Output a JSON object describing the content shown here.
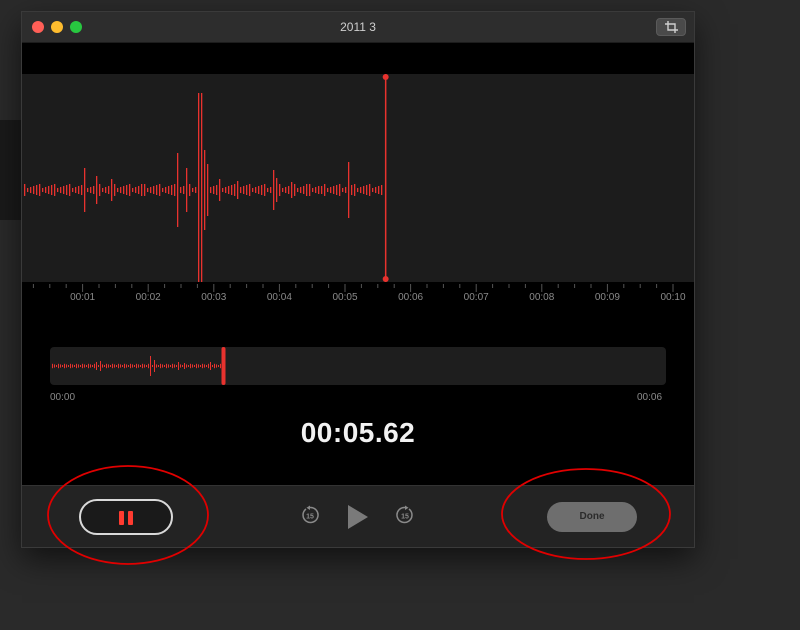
{
  "window": {
    "title": "2011 3"
  },
  "timeline": {
    "ticks": [
      "00:01",
      "00:02",
      "00:03",
      "00:04",
      "00:05",
      "00:06",
      "00:07",
      "00:08",
      "00:09",
      "00:10"
    ],
    "playhead_seconds": 5.62
  },
  "overview": {
    "start_label": "00:00",
    "end_label": "00:06"
  },
  "timer": {
    "value": "00:05.62"
  },
  "controls": {
    "done_label": "Done",
    "skip_back_seconds": "15",
    "skip_forward_seconds": "15"
  },
  "colors": {
    "accent_red": "#ff3b30",
    "waveform": "#e8322e",
    "annotation": "#e00000"
  },
  "icons": {
    "pause": "pause-icon",
    "play": "play-icon",
    "skip_back": "skip-back-15-icon",
    "skip_forward": "skip-forward-15-icon",
    "crop": "crop-icon"
  }
}
